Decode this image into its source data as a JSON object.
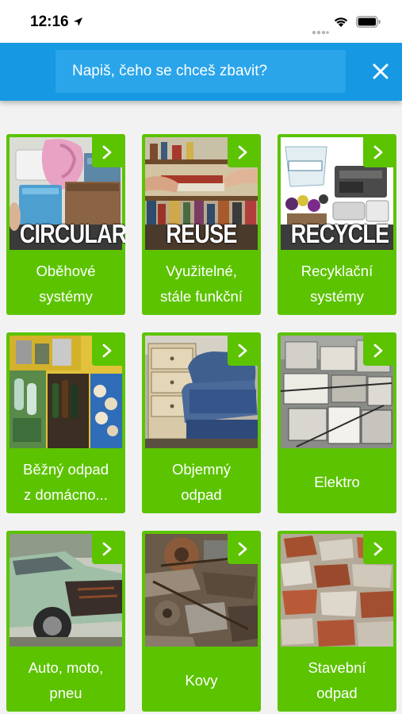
{
  "status_bar": {
    "time": "12:16"
  },
  "search": {
    "placeholder": "Napiš, čeho se chceš zbavit?"
  },
  "colors": {
    "header": "#1698e2",
    "tile": "#5cc300",
    "background": "#f2f2f2"
  },
  "tiles": [
    {
      "label": "Oběhové\nsystémy",
      "overlay": "CIRCULAR",
      "icon": "chevron-right-icon"
    },
    {
      "label": "Využitelné,\nstále funkční",
      "overlay": "REUSE",
      "icon": "chevron-right-icon"
    },
    {
      "label": "Recyklační\nsystémy",
      "overlay": "RECYCLE",
      "icon": "chevron-right-icon"
    },
    {
      "label": "Běžný odpad\nz domácno...",
      "overlay": "",
      "icon": "chevron-right-icon"
    },
    {
      "label": "Objemný\nodpad",
      "overlay": "",
      "icon": "chevron-right-icon"
    },
    {
      "label": "Elektro",
      "overlay": "",
      "icon": "chevron-right-icon"
    },
    {
      "label": "Auto, moto,\npneu",
      "overlay": "",
      "icon": "chevron-right-icon"
    },
    {
      "label": "Kovy",
      "overlay": "",
      "icon": "chevron-right-icon"
    },
    {
      "label": "Stavební\nodpad",
      "overlay": "",
      "icon": "chevron-right-icon"
    }
  ]
}
